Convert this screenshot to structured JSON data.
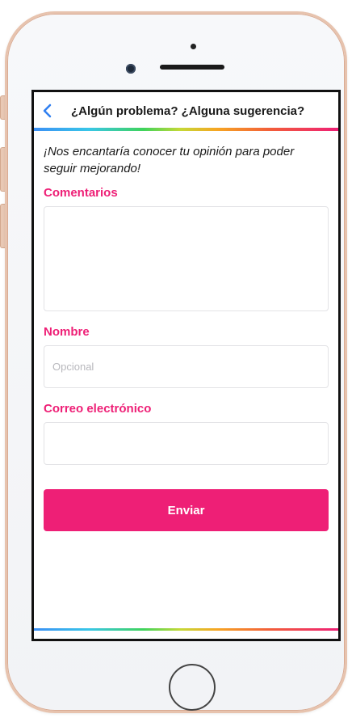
{
  "header": {
    "title": "¿Algún problema? ¿Alguna sugerencia?",
    "back_icon": "chevron-left-icon"
  },
  "intro": "¡Nos encantaría conocer tu opinión para poder seguir mejorando!",
  "form": {
    "comments_label": "Comentarios",
    "comments_value": "",
    "name_label": "Nombre",
    "name_placeholder": "Opcional",
    "name_value": "",
    "email_label": "Correo electrónico",
    "email_value": "",
    "submit_label": "Enviar"
  },
  "colors": {
    "accent": "#ee1f76",
    "back_arrow": "#2f7ff0"
  }
}
